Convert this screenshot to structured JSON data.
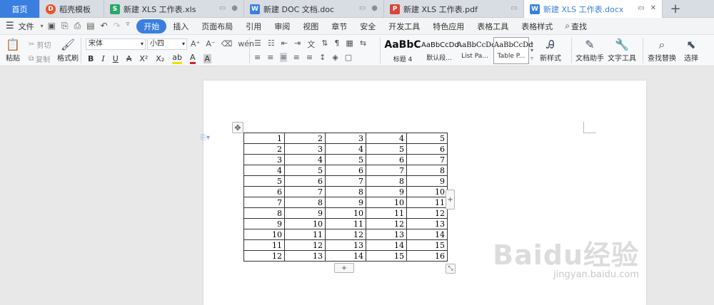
{
  "tabs": {
    "home": "首页",
    "items": [
      {
        "label": "稻壳模板",
        "icon": "D",
        "color": "#e8542a"
      },
      {
        "label": "新建 XLS 工作表.xls",
        "icon": "S",
        "color": "#2aa86a"
      },
      {
        "label": "新建 DOC 文档.doc",
        "icon": "W",
        "color": "#3a7fe0"
      },
      {
        "label": "新建 XLS 工作表.pdf",
        "icon": "P",
        "color": "#d9463b"
      },
      {
        "label": "新建 XLS 工作表.docx",
        "icon": "W",
        "color": "#3a7fe0"
      }
    ],
    "add": "+"
  },
  "menu": {
    "file": "文件",
    "items": [
      "开始",
      "插入",
      "页面布局",
      "引用",
      "审阅",
      "视图",
      "章节",
      "安全",
      "开发工具",
      "特色应用",
      "表格工具",
      "表格样式"
    ],
    "search": "查找"
  },
  "ribbon": {
    "paste": "粘贴",
    "cut": "剪切",
    "copy": "复制",
    "format_painter": "格式刷",
    "font_name": "宋体",
    "font_size": "小四",
    "bold": "B",
    "italic": "I",
    "underline": "U",
    "font_color": "A",
    "styles": [
      {
        "preview": "AaBbC",
        "caption": "标题 4"
      },
      {
        "preview": "AaBbCcDd",
        "caption": "默认段..."
      },
      {
        "preview": "AaBbCcDd",
        "caption": "List Pa..."
      },
      {
        "preview": "AaBbCcDd",
        "caption": "Table P..."
      }
    ],
    "new_style": "新样式",
    "doc_assistant": "文档助手",
    "text_tools": "文字工具",
    "find_replace": "查找替换",
    "select": "选择"
  },
  "table_rows": [
    [
      "1",
      "2",
      "3",
      "4",
      "5"
    ],
    [
      "2",
      "3",
      "4",
      "5",
      "6"
    ],
    [
      "3",
      "4",
      "5",
      "6",
      "7"
    ],
    [
      "4",
      "5",
      "6",
      "7",
      "8"
    ],
    [
      "5",
      "6",
      "7",
      "8",
      "9"
    ],
    [
      "6",
      "7",
      "8",
      "9",
      "10"
    ],
    [
      "7",
      "8",
      "9",
      "10",
      "11"
    ],
    [
      "8",
      "9",
      "10",
      "11",
      "12"
    ],
    [
      "9",
      "10",
      "11",
      "12",
      "13"
    ],
    [
      "10",
      "11",
      "12",
      "13",
      "14"
    ],
    [
      "11",
      "12",
      "13",
      "14",
      "15"
    ],
    [
      "12",
      "13",
      "14",
      "15",
      "16"
    ]
  ],
  "watermark": {
    "logo": "Baidu经验",
    "url": "jingyan.baidu.com"
  }
}
